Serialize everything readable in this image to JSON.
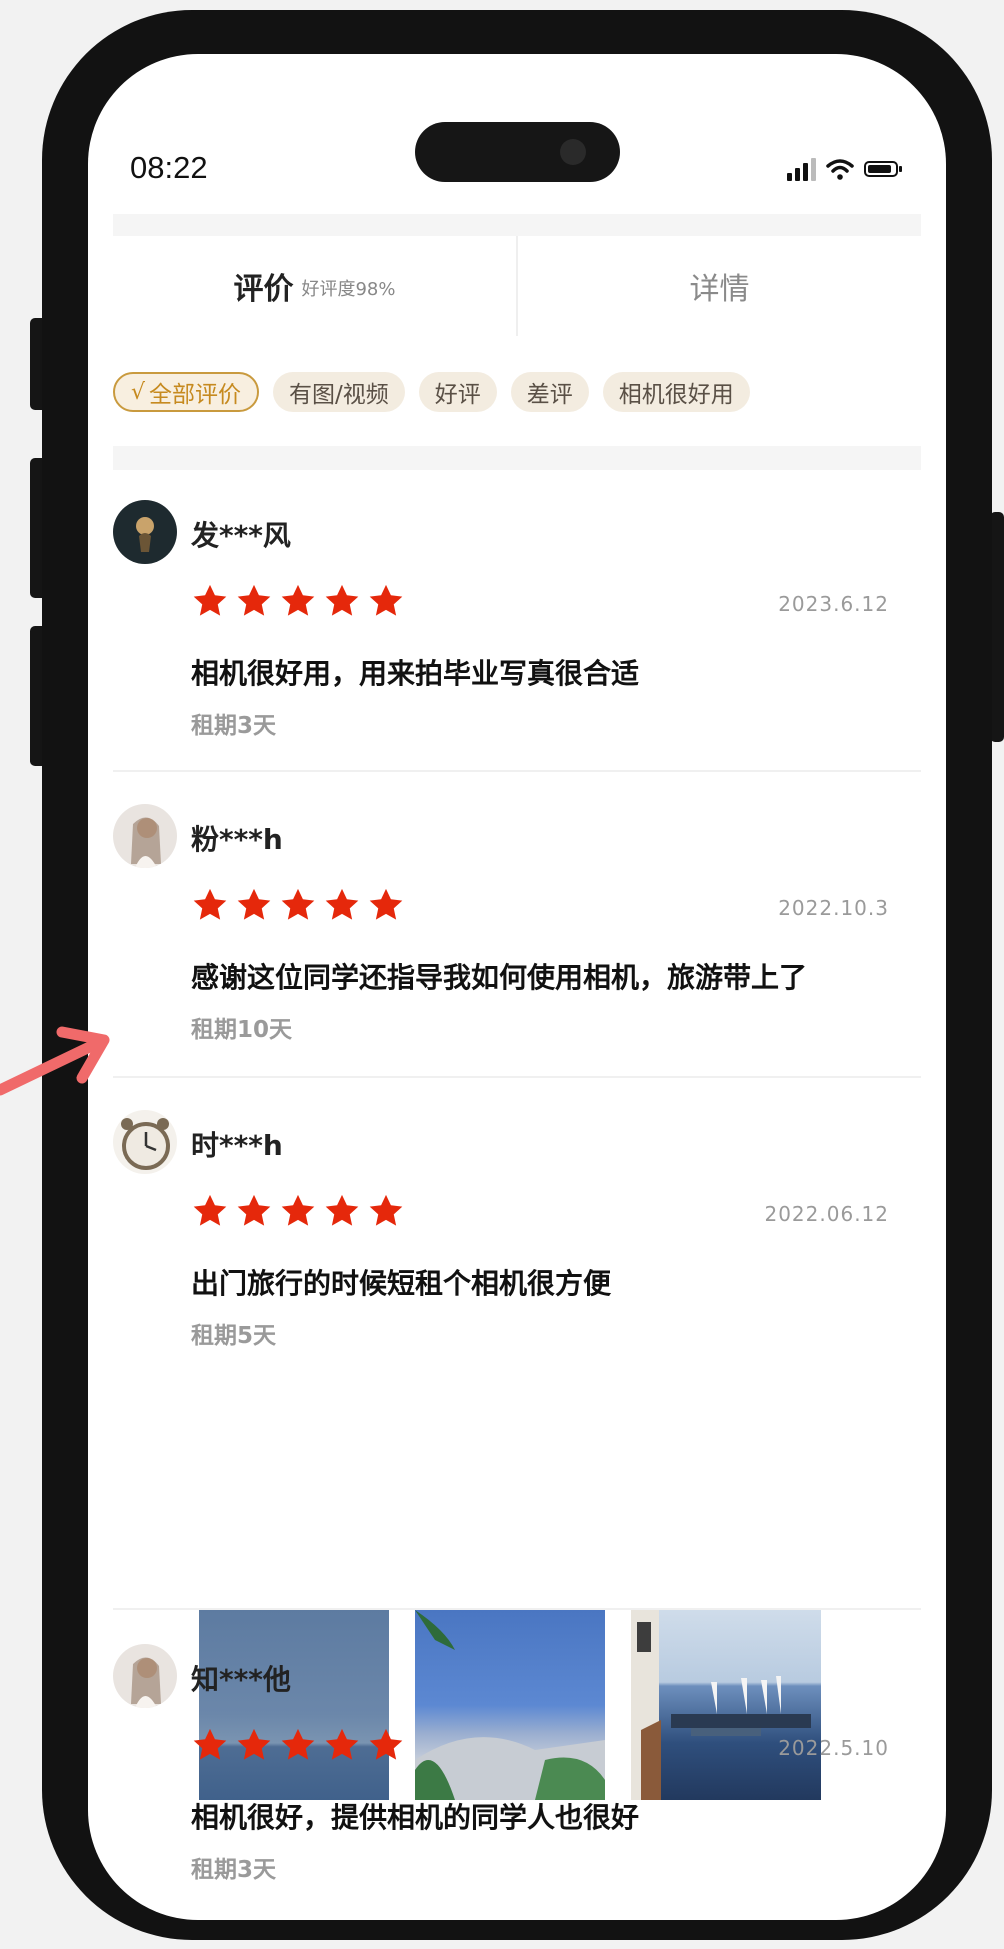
{
  "status": {
    "time": "08:22",
    "icons": [
      "cellular-signal-icon",
      "wifi-icon",
      "battery-icon"
    ]
  },
  "tabs": [
    {
      "label": "评价",
      "sub": "好评度98%"
    },
    {
      "label": "详情",
      "sub": ""
    }
  ],
  "filters": [
    {
      "label": "全部评价",
      "active": true
    },
    {
      "label": "有图/视频",
      "active": false
    },
    {
      "label": "好评",
      "active": false
    },
    {
      "label": "差评",
      "active": false
    },
    {
      "label": "相机很好用",
      "active": false
    }
  ],
  "reviews": [
    {
      "user": "发***风",
      "rating": 5,
      "date": "2023.6.12",
      "content": "相机很好用，用来拍毕业写真很合适",
      "period": "租期3天"
    },
    {
      "user": "粉***h",
      "rating": 5,
      "date": "2022.10.3",
      "content": "感谢这位同学还指导我如何使用相机，旅游带上了",
      "period": "租期10天"
    },
    {
      "user": "时***h",
      "rating": 5,
      "date": "2022.06.12",
      "content": "出门旅行的时候短租个相机很方便",
      "period": "租期5天",
      "photos": 3
    },
    {
      "user": "知***他",
      "rating": 5,
      "date": "2022.5.10",
      "content": "相机很好，提供相机的同学人也很好",
      "period": "租期3天"
    }
  ],
  "colors": {
    "star": "#e5280b",
    "chip_active": "#c99a3e",
    "annotation_arrow": "#f06a6a"
  }
}
